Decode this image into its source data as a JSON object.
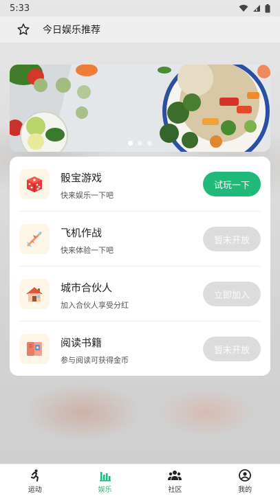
{
  "status_bar": {
    "time": "5:33",
    "icons": [
      "wifi-icon",
      "signal-icon",
      "battery-icon"
    ]
  },
  "header": {
    "icon": "star-icon",
    "title": "今日娱乐推荐"
  },
  "banner": {
    "image": "food-salad-bowl-photo",
    "dots_total": 3,
    "active_dot": 1
  },
  "items": [
    {
      "icon": "dice-icon",
      "title": "骰宝游戏",
      "subtitle": "快来娱乐一下吧",
      "button": "试玩一下",
      "enabled": true
    },
    {
      "icon": "plane-icon",
      "title": "飞机作战",
      "subtitle": "快来体验一下吧",
      "button": "暂未开放",
      "enabled": false
    },
    {
      "icon": "house-icon",
      "title": "城市合伙人",
      "subtitle": "加入合伙人享受分红",
      "button": "立即加入",
      "enabled": false
    },
    {
      "icon": "book-icon",
      "title": "阅读书籍",
      "subtitle": "参与阅读可获得金币",
      "button": "暂未开放",
      "enabled": false
    }
  ],
  "tabs": [
    {
      "icon": "running-icon",
      "label": "运动",
      "active": false
    },
    {
      "icon": "bar-chart-icon",
      "label": "娱乐",
      "active": true
    },
    {
      "icon": "community-icon",
      "label": "社区",
      "active": false
    },
    {
      "icon": "profile-icon",
      "label": "我的",
      "active": false
    }
  ],
  "colors": {
    "accent": "#1fb97a",
    "disabled_button": "#dcdcdc",
    "icon_bg": "#fdf6e7"
  }
}
